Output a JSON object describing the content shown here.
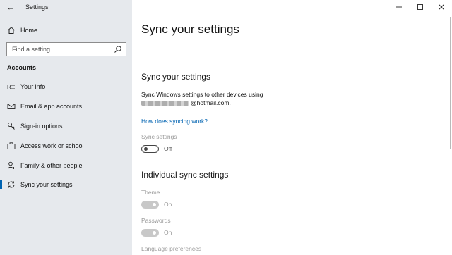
{
  "window": {
    "title": "Settings",
    "back_glyph": "←",
    "controls": {
      "minimize": "—",
      "maximize": "☐",
      "close": "✕"
    }
  },
  "sidebar": {
    "home_label": "Home",
    "search_placeholder": "Find a setting",
    "section_label": "Accounts",
    "items": [
      {
        "label": "Your info",
        "icon": "your-info-icon"
      },
      {
        "label": "Email & app accounts",
        "icon": "email-icon"
      },
      {
        "label": "Sign-in options",
        "icon": "key-icon"
      },
      {
        "label": "Access work or school",
        "icon": "briefcase-icon"
      },
      {
        "label": "Family & other people",
        "icon": "person-icon"
      },
      {
        "label": "Sync your settings",
        "icon": "sync-icon",
        "selected": true
      }
    ]
  },
  "main": {
    "page_title": "Sync your settings",
    "sync_heading": "Sync your settings",
    "sync_description": "Sync Windows settings to other devices using",
    "account_email_suffix": "@hotmail.com.",
    "link": "How does syncing work?",
    "sync_settings": {
      "label": "Sync settings",
      "state": "Off"
    },
    "individual_heading": "Individual sync settings",
    "individual": [
      {
        "label": "Theme",
        "state": "On"
      },
      {
        "label": "Passwords",
        "state": "On"
      }
    ],
    "language_label": "Language preferences"
  },
  "colors": {
    "accent": "#0063b1",
    "sidebar_bg": "#e6e9ed",
    "disabled_text": "#9a9a9a"
  }
}
